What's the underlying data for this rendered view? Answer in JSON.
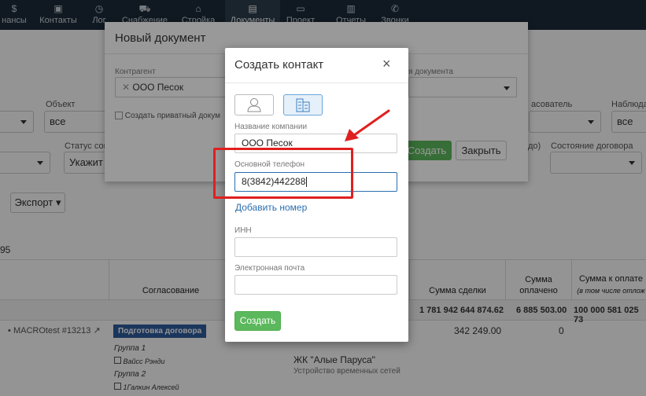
{
  "nav": {
    "items": [
      {
        "label": "нансы",
        "icon": "finance-icon"
      },
      {
        "label": "Контакты",
        "icon": "contacts-icon"
      },
      {
        "label": "Лог",
        "icon": "history-icon"
      },
      {
        "label": "Снабжение",
        "icon": "supply-icon"
      },
      {
        "label": "Стройка",
        "icon": "construction-icon"
      },
      {
        "label": "Документы",
        "icon": "documents-icon"
      },
      {
        "label": "Проект",
        "icon": "project-icon"
      },
      {
        "label": "Отчеты",
        "icon": "reports-icon"
      },
      {
        "label": "Звонки",
        "icon": "phone-icon"
      }
    ]
  },
  "page": {
    "object_label": "Объект",
    "object_value": "все",
    "status_label": "Статус согл",
    "status_value": "Укажит",
    "creator_label": "асователь",
    "observer_label": "Наблюда",
    "observer_value": "все",
    "contract_state_label": "Состояние договора",
    "extra_label": "до)",
    "export_label": "Экспорт",
    "count_text": "95",
    "columns": {
      "approval": "Согласование",
      "deal_sum": "Сумма сделки",
      "paid_sum": "Сумма оплачено",
      "pay_sum": "Сумма к оплате",
      "pay_sum_note": "(в том числе отлож"
    },
    "totals": {
      "deal": "1 781 942 644 874.62",
      "paid": "6 885 503.00",
      "pay": "100 000 581 025 73"
    },
    "row": {
      "ref": "MACROtest #13213",
      "stage_badge": "Подготовка договора",
      "group1": "Группа 1",
      "person1": "Вайсс Рэнди",
      "group2": "Группа 2",
      "person2": "1Галкин Алексей",
      "project": "ЖК \"Алые Паруса\"",
      "project_sub": "Устройство временных сетей",
      "deal": "342 249.00",
      "paid": "0"
    }
  },
  "doc_modal": {
    "title": "Новый документ",
    "counterparty_label": "Контрагент",
    "counterparty_value": "ООО Песок",
    "doc_type_label": "я документа",
    "private_label": "Создать приватный докум",
    "create_label": "Создать",
    "close_label": "Закрыть"
  },
  "contact_modal": {
    "title": "Создать контакт",
    "company_label": "Название компании",
    "company_value": "ООО Песок",
    "phone_label": "Основной телефон",
    "phone_value": "8(3842)442288",
    "add_number_label": "Добавить номер",
    "inn_label": "ИНН",
    "inn_value": "",
    "email_label": "Электронная почта",
    "email_value": "",
    "submit_label": "Создать"
  },
  "colors": {
    "nav_bg": "#1c2b39",
    "annotation": "#e02020",
    "primary_green": "#5cb85c",
    "link": "#2a6fb0",
    "badge": "#2e5d9f"
  }
}
